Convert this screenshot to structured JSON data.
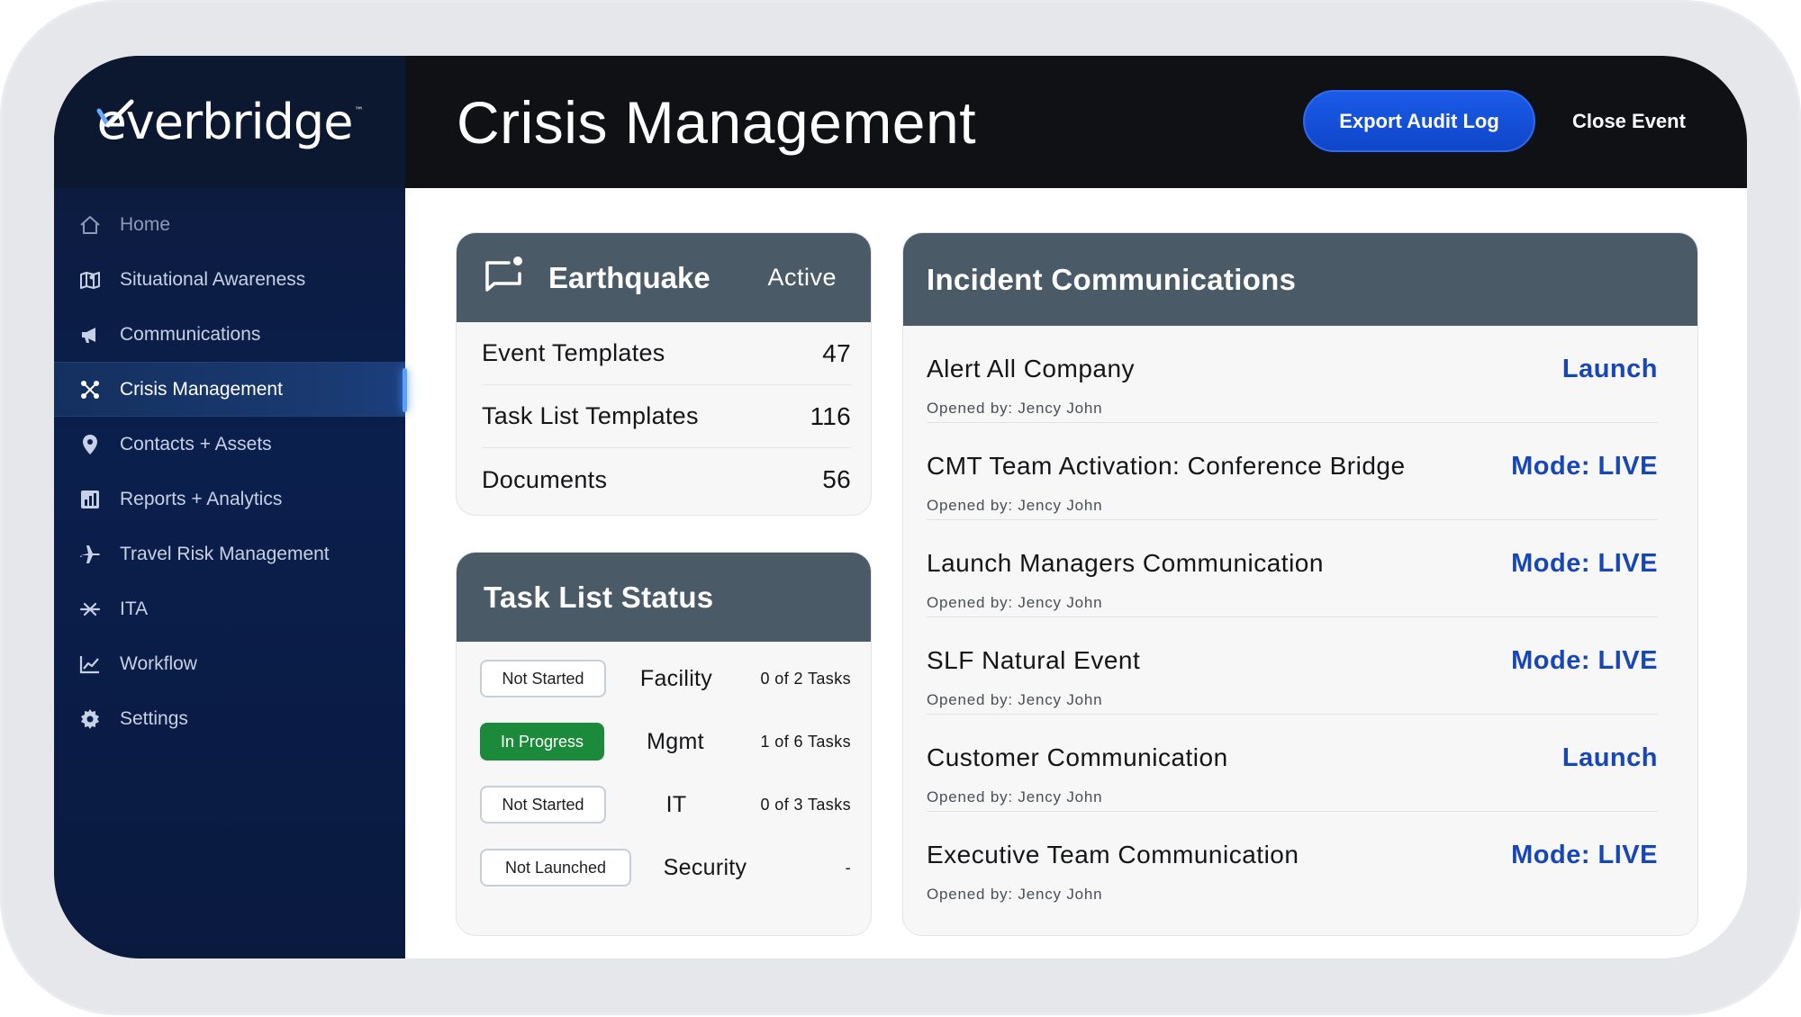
{
  "app": {
    "brand": "everbridge",
    "brand_tm": "™"
  },
  "sidebar": {
    "items": [
      {
        "label": "Home",
        "icon": "home-icon"
      },
      {
        "label": "Situational Awareness",
        "icon": "map-icon"
      },
      {
        "label": "Communications",
        "icon": "megaphone-icon"
      },
      {
        "label": "Crisis Management",
        "icon": "crisis-icon",
        "active": true
      },
      {
        "label": "Contacts + Assets",
        "icon": "location-pin-icon"
      },
      {
        "label": "Reports + Analytics",
        "icon": "bar-chart-icon"
      },
      {
        "label": "Travel Risk Management",
        "icon": "airplane-icon"
      },
      {
        "label": "ITA",
        "icon": "ita-icon"
      },
      {
        "label": "Workflow",
        "icon": "line-chart-icon"
      },
      {
        "label": "Settings",
        "icon": "gear-icon"
      }
    ]
  },
  "header": {
    "title": "Crisis Management",
    "export_label": "Export Audit Log",
    "close_label": "Close Event"
  },
  "event": {
    "name": "Earthquake",
    "status": "Active",
    "counts": [
      {
        "label": "Event Templates",
        "value": "47"
      },
      {
        "label": "Task List Templates",
        "value": "116"
      },
      {
        "label": "Documents",
        "value": "56"
      }
    ]
  },
  "task_status": {
    "title": "Task List Status",
    "rows": [
      {
        "status": "Not Started",
        "team": "Facility",
        "tasks": "0 of 2 Tasks"
      },
      {
        "status": "In Progress",
        "team": "Mgmt",
        "tasks": "1 of 6 Tasks"
      },
      {
        "status": "Not Started",
        "team": "IT",
        "tasks": "0 of 3 Tasks"
      },
      {
        "status": "Not Launched",
        "team": "Security",
        "tasks": "-"
      }
    ]
  },
  "communications": {
    "title": "Incident Communications",
    "items": [
      {
        "title": "Alert All Company",
        "opened_by": "Opened by: Jency John",
        "action": "Launch"
      },
      {
        "title": "CMT Team Activation: Conference Bridge",
        "opened_by": "Opened by: Jency John",
        "action": "Mode: LIVE"
      },
      {
        "title": "Launch Managers Communication",
        "opened_by": "Opened by: Jency John",
        "action": "Mode: LIVE"
      },
      {
        "title": "SLF Natural Event",
        "opened_by": "Opened by: Jency John",
        "action": "Mode: LIVE"
      },
      {
        "title": "Customer Communication",
        "opened_by": "Opened by: Jency John",
        "action": "Launch"
      },
      {
        "title": "Executive Team Communication",
        "opened_by": "Opened by: Jency John",
        "action": "Mode: LIVE"
      }
    ]
  },
  "colors": {
    "header_bg": "#101114",
    "sidebar_bg": "#0b1f4d",
    "accent_blue": "#1b5be8",
    "card_head": "#4a5a67",
    "in_progress_green": "#1c8a3b",
    "action_link": "#1747b6"
  }
}
